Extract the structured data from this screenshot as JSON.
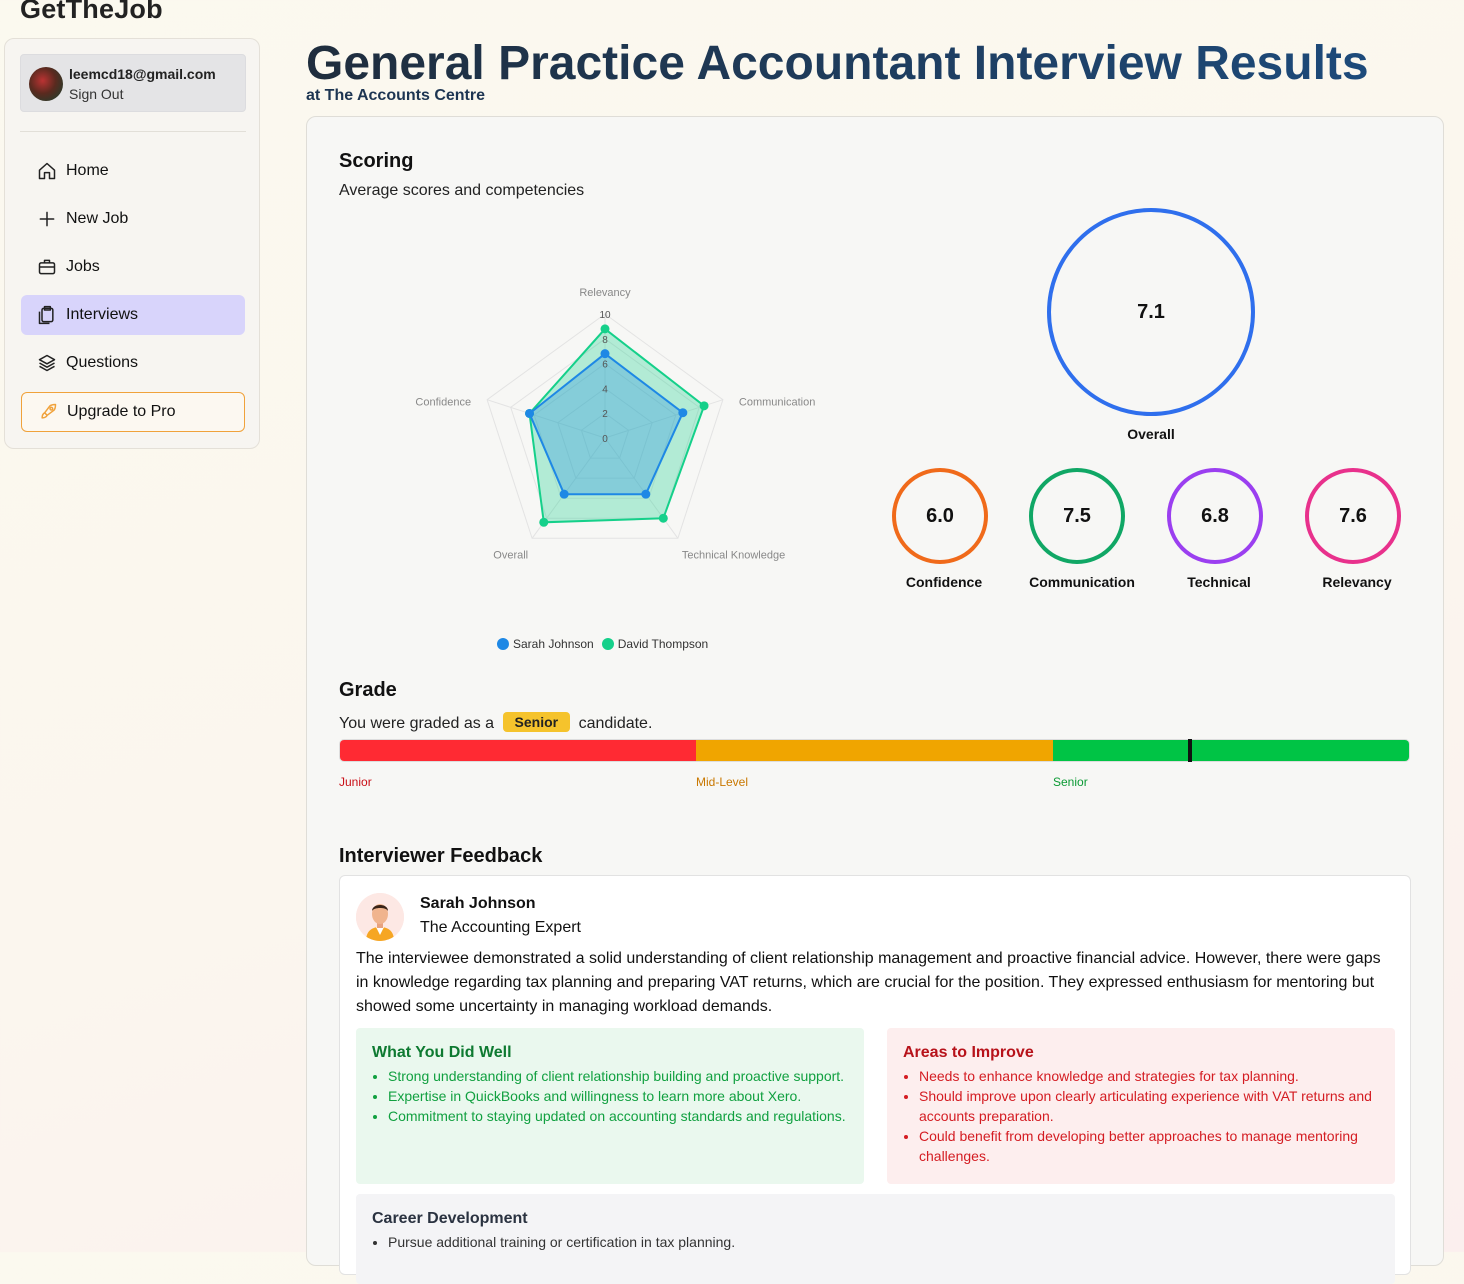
{
  "brand": "GetTheJob",
  "user": {
    "email": "leemcd18@gmail.com",
    "sign_out": "Sign Out"
  },
  "nav": [
    {
      "label": "Home",
      "icon": "home-icon"
    },
    {
      "label": "New Job",
      "icon": "plus-icon"
    },
    {
      "label": "Jobs",
      "icon": "briefcase-icon"
    },
    {
      "label": "Interviews",
      "icon": "clipboard-icon",
      "active": true
    },
    {
      "label": "Questions",
      "icon": "layers-icon"
    },
    {
      "label": "Upgrade to Pro",
      "icon": "rocket-icon"
    }
  ],
  "page": {
    "title": "General Practice Accountant Interview Results",
    "subtitle": "at The Accounts Centre"
  },
  "scoring": {
    "heading": "Scoring",
    "description": "Average scores and competencies",
    "overall": {
      "value": "7.1",
      "label": "Overall",
      "color": "#2f6fed"
    },
    "metrics": [
      {
        "value": "6.0",
        "label": "Confidence",
        "color": "#f06a1a"
      },
      {
        "value": "7.5",
        "label": "Communication",
        "color": "#10a765"
      },
      {
        "value": "6.8",
        "label": "Technical",
        "color": "#9b3ff0"
      },
      {
        "value": "7.6",
        "label": "Relevancy",
        "color": "#e8318c"
      }
    ]
  },
  "chart_data": {
    "type": "radar",
    "axes": [
      "Relevancy",
      "Communication",
      "Technical Knowledge",
      "Overall",
      "Confidence"
    ],
    "range": [
      0,
      10
    ],
    "ticks": [
      "0",
      "2",
      "4",
      "6",
      "8",
      "10"
    ],
    "series": [
      {
        "name": "Sarah Johnson",
        "color": "#1e88e5",
        "values": [
          6.8,
          6.6,
          5.6,
          5.6,
          6.4
        ]
      },
      {
        "name": "David Thompson",
        "color": "#15d08a",
        "values": [
          8.8,
          8.4,
          8.0,
          8.4,
          6.4
        ]
      }
    ]
  },
  "grade": {
    "heading": "Grade",
    "prefix": "You were graded as a",
    "value": "Senior",
    "suffix": "candidate.",
    "position": 0.795,
    "levels": [
      {
        "label": "Junior",
        "color": "#ff2a33",
        "text_color": "#c90e16"
      },
      {
        "label": "Mid-Level",
        "color": "#f0a500",
        "text_color": "#c97800"
      },
      {
        "label": "Senior",
        "color": "#00c445",
        "text_color": "#0b9a34"
      }
    ]
  },
  "feedback": {
    "heading": "Interviewer Feedback",
    "interviewer": {
      "name": "Sarah Johnson",
      "role": "The Accounting Expert"
    },
    "summary": "The interviewee demonstrated a solid understanding of client relationship management and proactive financial advice. However, there were gaps in knowledge regarding tax planning and preparing VAT returns, which are crucial for the position. They expressed enthusiasm for mentoring but showed some uncertainty in managing workload demands.",
    "well": {
      "title": "What You Did Well",
      "items": [
        "Strong understanding of client relationship building and proactive support.",
        "Expertise in QuickBooks and willingness to learn more about Xero.",
        "Commitment to staying updated on accounting standards and regulations."
      ]
    },
    "improve": {
      "title": "Areas to Improve",
      "items": [
        "Needs to enhance knowledge and strategies for tax planning.",
        "Should improve upon clearly articulating experience with VAT returns and accounts preparation.",
        "Could benefit from developing better approaches to manage mentoring challenges."
      ]
    },
    "career": {
      "title": "Career Development",
      "items": [
        "Pursue additional training or certification in tax planning."
      ]
    }
  }
}
